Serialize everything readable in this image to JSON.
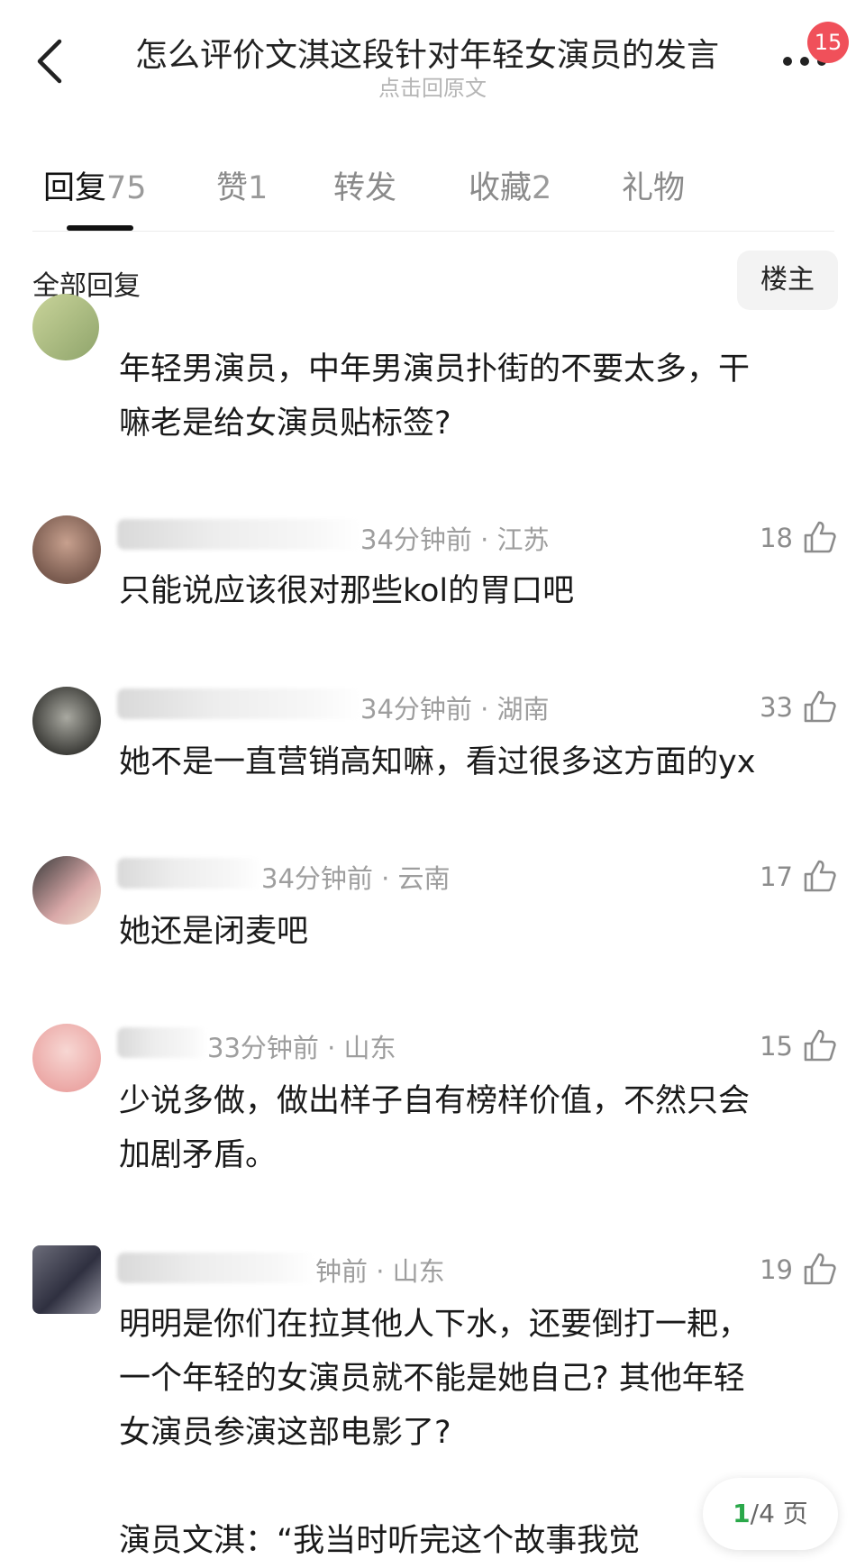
{
  "header": {
    "title": "怎么评价文淇这段针对年轻女演员的发言",
    "subtitle": "点击回原文",
    "badge_count": "15"
  },
  "tabs": [
    {
      "name": "回复",
      "count": "75"
    },
    {
      "name": "赞",
      "count": "1"
    },
    {
      "name": "转发",
      "count": ""
    },
    {
      "name": "收藏",
      "count": "2"
    },
    {
      "name": "礼物",
      "count": ""
    }
  ],
  "section": {
    "all_replies": "全部回复",
    "owner_button": "楼主"
  },
  "comments": [
    {
      "meta": "",
      "likes": "",
      "content": [
        "年轻男演员，中年男演员扑街的不要太多，干",
        "嘛老是给女演员贴标签?"
      ]
    },
    {
      "meta": "34分钟前 · 江苏",
      "likes": "18",
      "content": [
        "只能说应该很对那些kol的胃口吧"
      ]
    },
    {
      "meta": "34分钟前 · 湖南",
      "likes": "33",
      "content": [
        "她不是一直营销高知嘛，看过很多这方面的yx"
      ]
    },
    {
      "meta": "34分钟前 · 云南",
      "likes": "17",
      "content": [
        "她还是闭麦吧"
      ]
    },
    {
      "meta": "33分钟前 · 山东",
      "likes": "15",
      "content": [
        "少说多做，做出样子自有榜样价值，不然只会",
        "加剧矛盾。"
      ]
    },
    {
      "meta": "钟前 · 山东",
      "likes": "19",
      "content": [
        "明明是你们在拉其他人下水，还要倒打一耙，",
        "一个年轻的女演员就不能是她自己? 其他年轻",
        "女演员参演这部电影了?",
        "",
        "演员文淇：“我当时听完这个故事我觉"
      ]
    }
  ],
  "pager": {
    "current": "1",
    "total": "/4 页"
  },
  "colors": {
    "badge": "#f0505a",
    "pager_current": "#2aa84a"
  }
}
